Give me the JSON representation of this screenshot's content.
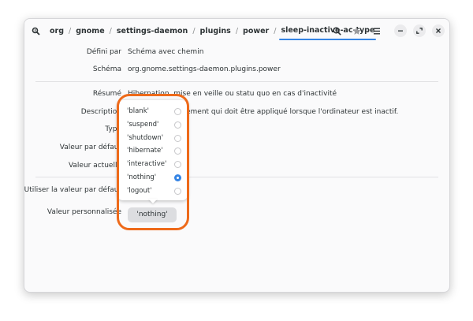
{
  "header": {
    "breadcrumbs": [
      "org",
      "gnome",
      "settings-daemon",
      "plugins",
      "power",
      "sleep-inactive-ac-type"
    ],
    "separator": "/",
    "icons": {
      "app": "dconf-editor-icon",
      "search": "search-icon",
      "bookmark": "star-icon",
      "menu": "hamburger-menu-icon",
      "minimize": "minimize-icon",
      "maximize": "maximize-icon",
      "close": "close-icon"
    }
  },
  "fields": {
    "defined_by": {
      "label": "Défini par",
      "value": "Schéma avec chemin"
    },
    "schema": {
      "label": "Schéma",
      "value": "org.gnome.settings-daemon.plugins.power"
    },
    "summary": {
      "label": "Résumé",
      "value": "Hibernation, mise en veille ou statu quo en cas d'inactivité"
    },
    "description": {
      "label": "Description",
      "value": "ement qui doit être appliqué lorsque l'ordinateur est inactif."
    },
    "type": {
      "label": "Type"
    },
    "default_value": {
      "label": "Valeur par défaut"
    },
    "current_value": {
      "label": "Valeur actuelle"
    },
    "use_default": {
      "label": "Utiliser la valeur par défaut"
    },
    "custom_value": {
      "label": "Valeur personnalisée",
      "value": "'nothing'"
    }
  },
  "popover": {
    "options": [
      {
        "label": "'blank'",
        "selected": false
      },
      {
        "label": "'suspend'",
        "selected": false
      },
      {
        "label": "'shutdown'",
        "selected": false
      },
      {
        "label": "'hibernate'",
        "selected": false
      },
      {
        "label": "'interactive'",
        "selected": false
      },
      {
        "label": "'nothing'",
        "selected": true
      },
      {
        "label": "'logout'",
        "selected": false
      }
    ]
  },
  "colors": {
    "accent": "#3584e4",
    "highlight": "#ee6a1a"
  }
}
